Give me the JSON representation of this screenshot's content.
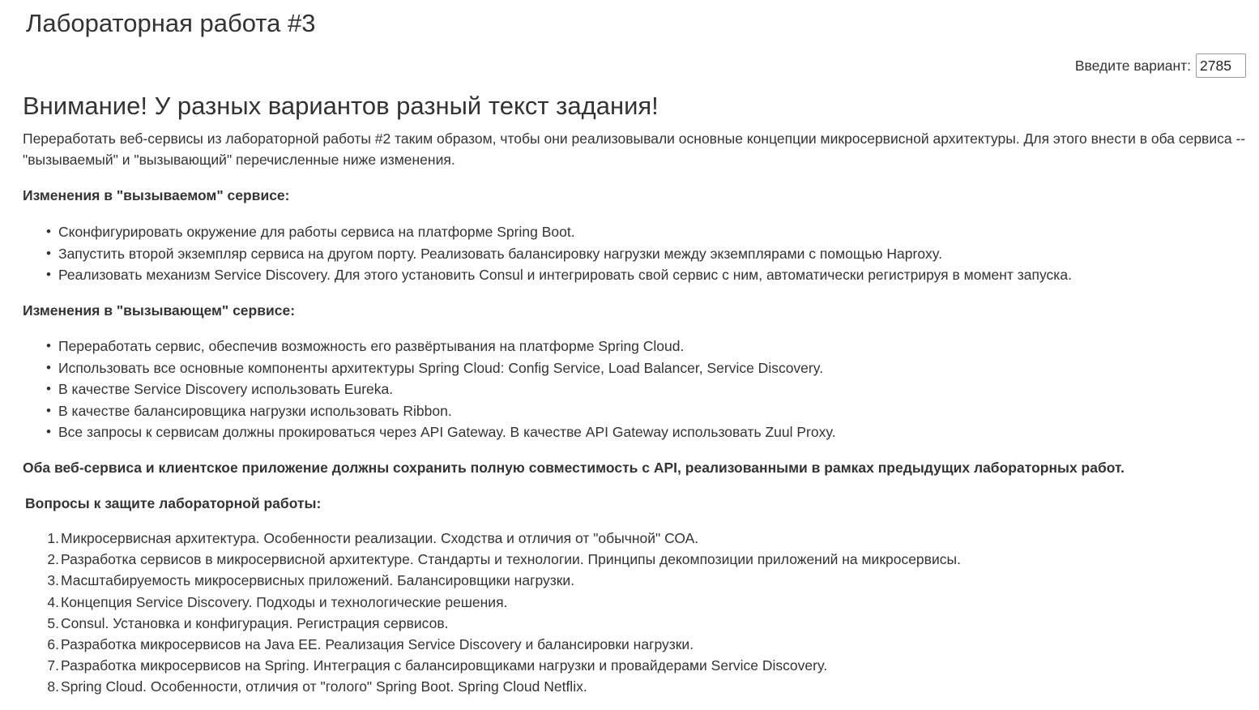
{
  "header": {
    "title": "Лабораторная работа #3"
  },
  "variant": {
    "label": "Введите вариант:",
    "value": "2785"
  },
  "warning": "Внимание! У разных вариантов разный текст задания!",
  "intro": "Переработать веб-сервисы из лабораторной работы #2 таким образом, чтобы они реализовывали основные концепции микросервисной архитектуры. Для этого внести в оба сервиса -- \"вызываемый\" и \"вызывающий\" перечисленные ниже изменения.",
  "called_service": {
    "heading": "Изменения в \"вызываемом\" сервисе:",
    "items": [
      "Сконфигурировать окружение для работы сервиса на платформе Spring Boot.",
      "Запустить второй экземпляр сервиса на другом порту. Реализовать балансировку нагрузки между экземплярами с помощью Haproxy.",
      "Реализовать механизм Service Discovery. Для этого установить Consul и интегрировать свой сервис с ним, автоматически регистрируя в момент запуска."
    ]
  },
  "calling_service": {
    "heading": "Изменения в \"вызывающем\" сервисе:",
    "items": [
      "Переработать сервис, обеспечив возможность его развёртывания на платформе Spring Cloud.",
      "Использовать все основные компоненты архитектуры Spring Cloud: Config Service, Load Balancer, Service Discovery.",
      "В качестве Service Discovery использовать Eureka.",
      "В качестве балансировщика нагрузки использовать Ribbon.",
      "Все запросы к сервисам должны прокироваться через API Gateway. В качестве API Gateway использовать Zuul Proxy."
    ]
  },
  "compat_note": "Оба веб-сервиса и клиентское приложение должны сохранить полную совместимость с API, реализованными в рамках предыдущих лабораторных работ.",
  "questions": {
    "heading": "Вопросы к защите лабораторной работы:",
    "items": [
      "Микросервисная архитектура. Особенности реализации. Сходства и отличия от \"обычной\" СОА.",
      "Разработка сервисов в микросервисной архитектуре. Стандарты и технологии. Принципы декомпозиции приложений на микросервисы.",
      "Масштабируемость микросервисных приложений. Балансировщики нагрузки.",
      "Концепция Service Discovery. Подходы и технологические решения.",
      "Consul. Установка и конфигурация. Регистрация сервисов.",
      "Разработка микросервисов на Java EE. Реализация Service Discovery и балансировки нагрузки.",
      "Разработка микросервисов на Spring. Интеграция с балансировщиками нагрузки и провайдерами Service Discovery.",
      "Spring Cloud. Особенности, отличия от \"голого\" Spring Boot. Spring Cloud Netflix."
    ]
  }
}
